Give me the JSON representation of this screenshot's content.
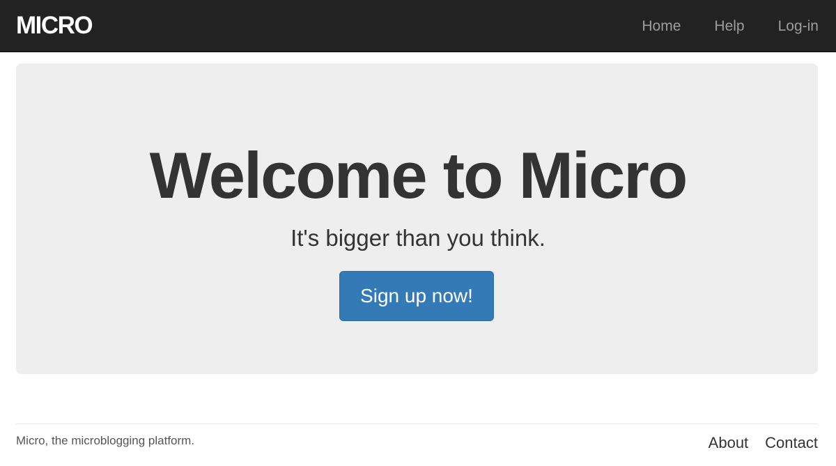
{
  "header": {
    "logo": "MICRO",
    "nav": [
      {
        "label": "Home"
      },
      {
        "label": "Help"
      },
      {
        "label": "Log-in"
      }
    ]
  },
  "hero": {
    "title": "Welcome to Micro",
    "subtitle": "It's bigger than you think.",
    "cta_label": "Sign up now!"
  },
  "footer": {
    "tagline": "Micro, the microblogging platform.",
    "links": [
      {
        "label": "About"
      },
      {
        "label": "Contact"
      }
    ]
  },
  "colors": {
    "navbar_bg": "#222222",
    "jumbotron_bg": "#eeeeee",
    "primary_button": "#337ab7"
  }
}
